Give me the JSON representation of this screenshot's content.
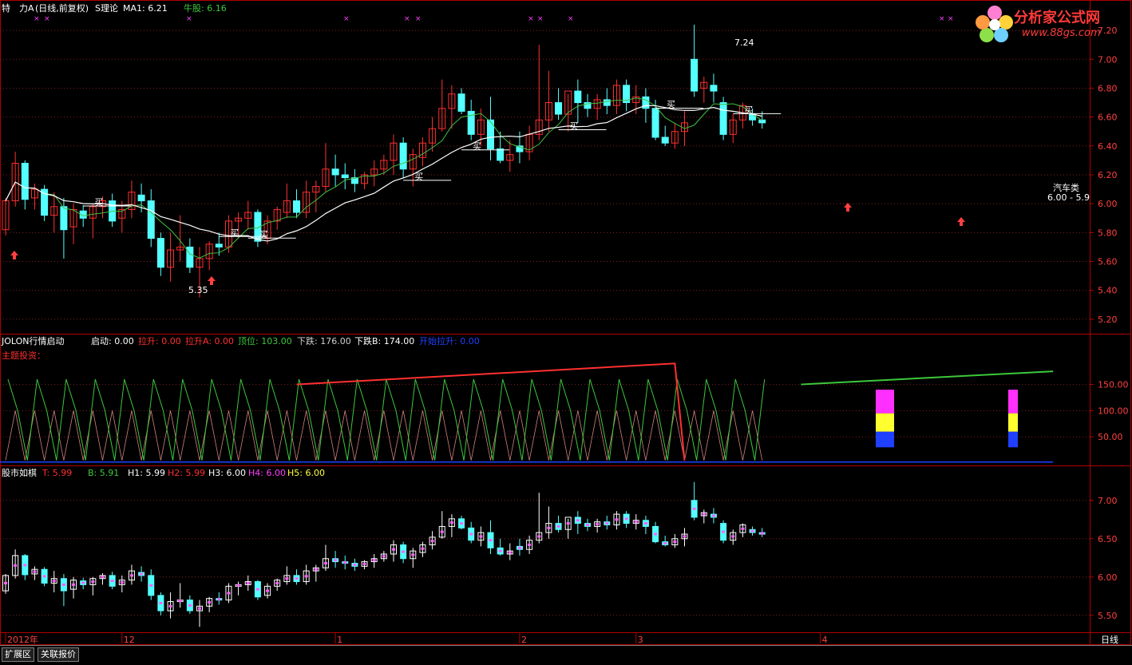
{
  "header": {
    "stock_name": "特　力A",
    "period_mode": "(日线,前复权)",
    "indicator_name": "S理论",
    "ma_label": "MA1: 6.21",
    "bull_label": "牛股: 6.16"
  },
  "panel2_header": {
    "name": "JOLON行情启动",
    "items": [
      {
        "text": "启动: 0.00",
        "color": "#ffffff"
      },
      {
        "text": "拉升: 0.00",
        "color": "#ff3030"
      },
      {
        "text": "拉升A: 0.00",
        "color": "#ff3030"
      },
      {
        "text": "顶位: 103.00",
        "color": "#3cc83c"
      },
      {
        "text": "下跌: 176.00",
        "color": "#d0d0d0"
      },
      {
        "text": "下跌B: 174.00",
        "color": "#ffffff"
      },
      {
        "text": "开始拉升: 0.00",
        "color": "#2040ff"
      }
    ],
    "sub_label": "主题投资："
  },
  "panel3_header": {
    "name": "股市如棋",
    "items": [
      {
        "text": "T: 5.99",
        "color": "#ff3030"
      },
      {
        "text": "B: 5.91",
        "color": "#3cc83c"
      },
      {
        "text": "H1: 5.99",
        "color": "#ffffff"
      },
      {
        "text": "H2: 5.99",
        "color": "#ff3030"
      },
      {
        "text": "H3: 6.00",
        "color": "#ffffff"
      },
      {
        "text": "H4: 6.00",
        "color": "#ff40ff"
      },
      {
        "text": "H5: 6.00",
        "color": "#ffff40"
      }
    ]
  },
  "logo": {
    "title": "分析家公式网",
    "url": "www.88gs.com"
  },
  "annotations": {
    "high_label": "7.24",
    "low_label": "5.35",
    "buy_label": "买",
    "sector_label": "汽车类",
    "price_range_label": "6.00 - 5.9"
  },
  "bottom_tabs": [
    "扩展区",
    "关联报价"
  ],
  "period_label": "日线",
  "colors": {
    "up": "#ff3030",
    "down": "#54ffff",
    "grid": "#802020",
    "axis": "#b00000"
  },
  "chart_data": [
    {
      "type": "candlestick",
      "title": "S理论",
      "y_ticks": [
        7.2,
        7.0,
        6.8,
        6.6,
        6.4,
        6.2,
        6.0,
        5.8,
        5.6,
        5.4,
        5.2
      ],
      "ylim": [
        5.1,
        7.3
      ],
      "x_ticks": [
        {
          "label": "2012年",
          "index": 0
        },
        {
          "label": "12",
          "index": 12
        },
        {
          "label": "1",
          "index": 34
        },
        {
          "label": "2",
          "index": 53
        },
        {
          "label": "3",
          "index": 65
        },
        {
          "label": "4",
          "index": 84
        }
      ],
      "ohlc": [
        [
          5.82,
          6.04,
          5.78,
          6.02
        ],
        [
          6.02,
          6.36,
          5.98,
          6.28
        ],
        [
          6.28,
          6.3,
          5.96,
          6.03
        ],
        [
          6.04,
          6.14,
          5.96,
          6.1
        ],
        [
          6.1,
          6.13,
          5.88,
          5.92
        ],
        [
          5.92,
          6.08,
          5.8,
          5.98
        ],
        [
          5.98,
          6.04,
          5.62,
          5.82
        ],
        [
          5.84,
          6.0,
          5.72,
          5.96
        ],
        [
          5.95,
          5.99,
          5.84,
          5.9
        ],
        [
          5.9,
          6.0,
          5.76,
          5.98
        ],
        [
          5.98,
          6.05,
          5.9,
          6.02
        ],
        [
          6.02,
          6.07,
          5.84,
          5.88
        ],
        [
          5.9,
          6.02,
          5.8,
          5.96
        ],
        [
          5.96,
          6.16,
          5.9,
          6.08
        ],
        [
          6.06,
          6.14,
          5.94,
          6.02
        ],
        [
          6.02,
          6.1,
          5.7,
          5.76
        ],
        [
          5.76,
          5.8,
          5.5,
          5.56
        ],
        [
          5.56,
          5.8,
          5.46,
          5.68
        ],
        [
          5.68,
          5.92,
          5.6,
          5.7
        ],
        [
          5.7,
          5.76,
          5.52,
          5.56
        ],
        [
          5.56,
          5.7,
          5.35,
          5.62
        ],
        [
          5.62,
          5.74,
          5.54,
          5.72
        ],
        [
          5.72,
          5.8,
          5.64,
          5.7
        ],
        [
          5.7,
          5.92,
          5.66,
          5.88
        ],
        [
          5.88,
          5.94,
          5.76,
          5.9
        ],
        [
          5.9,
          6.02,
          5.82,
          5.94
        ],
        [
          5.94,
          5.96,
          5.7,
          5.74
        ],
        [
          5.76,
          5.92,
          5.72,
          5.88
        ],
        [
          5.88,
          5.98,
          5.82,
          5.96
        ],
        [
          5.94,
          6.14,
          5.9,
          6.02
        ],
        [
          6.02,
          6.1,
          5.9,
          5.94
        ],
        [
          5.94,
          6.16,
          5.9,
          6.08
        ],
        [
          6.08,
          6.16,
          5.94,
          6.12
        ],
        [
          6.12,
          6.42,
          6.08,
          6.24
        ],
        [
          6.24,
          6.34,
          6.12,
          6.2
        ],
        [
          6.2,
          6.28,
          6.1,
          6.18
        ],
        [
          6.18,
          6.24,
          6.08,
          6.14
        ],
        [
          6.14,
          6.22,
          6.1,
          6.2
        ],
        [
          6.2,
          6.3,
          6.12,
          6.24
        ],
        [
          6.24,
          6.34,
          6.2,
          6.3
        ],
        [
          6.3,
          6.48,
          6.2,
          6.42
        ],
        [
          6.42,
          6.46,
          6.18,
          6.24
        ],
        [
          6.24,
          6.38,
          6.12,
          6.34
        ],
        [
          6.32,
          6.46,
          6.26,
          6.42
        ],
        [
          6.42,
          6.6,
          6.36,
          6.52
        ],
        [
          6.52,
          6.86,
          6.5,
          6.66
        ],
        [
          6.66,
          6.82,
          6.52,
          6.76
        ],
        [
          6.76,
          6.8,
          6.62,
          6.64
        ],
        [
          6.64,
          6.72,
          6.44,
          6.48
        ],
        [
          6.48,
          6.66,
          6.4,
          6.58
        ],
        [
          6.58,
          6.74,
          6.3,
          6.38
        ],
        [
          6.38,
          6.5,
          6.28,
          6.3
        ],
        [
          6.3,
          6.44,
          6.22,
          6.34
        ],
        [
          6.4,
          6.5,
          6.28,
          6.36
        ],
        [
          6.36,
          6.54,
          6.3,
          6.48
        ],
        [
          6.48,
          7.1,
          6.44,
          6.58
        ],
        [
          6.58,
          6.92,
          6.5,
          6.7
        ],
        [
          6.7,
          6.8,
          6.58,
          6.62
        ],
        [
          6.62,
          6.76,
          6.5,
          6.78
        ],
        [
          6.78,
          6.86,
          6.56,
          6.7
        ],
        [
          6.7,
          6.76,
          6.6,
          6.66
        ],
        [
          6.66,
          6.76,
          6.58,
          6.72
        ],
        [
          6.72,
          6.8,
          6.62,
          6.68
        ],
        [
          6.68,
          6.86,
          6.62,
          6.82
        ],
        [
          6.82,
          6.86,
          6.64,
          6.7
        ],
        [
          6.7,
          6.82,
          6.62,
          6.74
        ],
        [
          6.74,
          6.8,
          6.56,
          6.66
        ],
        [
          6.66,
          6.72,
          6.44,
          6.46
        ],
        [
          6.46,
          6.54,
          6.4,
          6.42
        ],
        [
          6.42,
          6.56,
          6.38,
          6.5
        ],
        [
          6.5,
          6.64,
          6.4,
          6.56
        ],
        [
          7.0,
          7.24,
          6.74,
          6.78
        ],
        [
          6.8,
          6.88,
          6.7,
          6.84
        ],
        [
          6.82,
          6.9,
          6.7,
          6.78
        ],
        [
          6.7,
          6.74,
          6.44,
          6.48
        ],
        [
          6.48,
          6.62,
          6.42,
          6.58
        ],
        [
          6.58,
          6.7,
          6.52,
          6.68
        ],
        [
          6.62,
          6.66,
          6.54,
          6.58
        ],
        [
          6.58,
          6.64,
          6.52,
          6.56
        ]
      ]
    },
    {
      "type": "line",
      "title": "JOLON行情启动",
      "y_ticks": [
        150.0,
        100.0,
        50.0
      ],
      "ylim": [
        0,
        200
      ],
      "series": [
        {
          "name": "拉升",
          "color": "#ff3030"
        },
        {
          "name": "顶位",
          "color": "#3cc83c"
        },
        {
          "name": "下跌",
          "color": "#d0d0d0"
        },
        {
          "name": "开始拉升",
          "color": "#2040ff"
        }
      ]
    },
    {
      "type": "candlestick",
      "title": "股市如棋",
      "y_ticks": [
        7.0,
        6.5,
        6.0,
        5.5
      ],
      "ylim": [
        5.3,
        7.3
      ]
    }
  ]
}
